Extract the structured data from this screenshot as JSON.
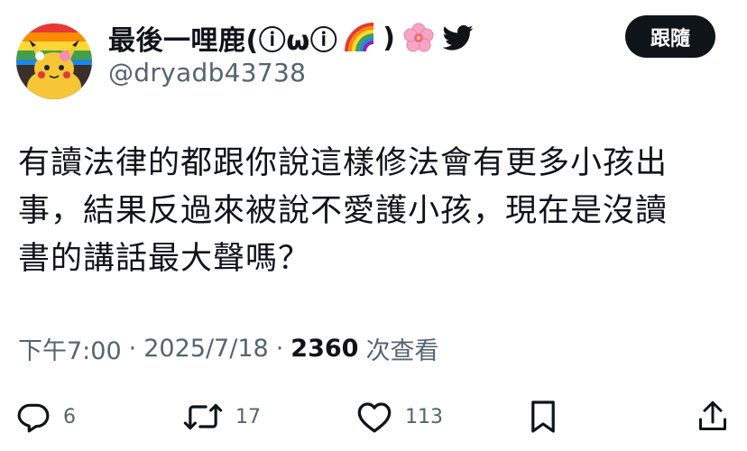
{
  "user": {
    "display_name": "最後一哩鹿(ⓘωⓘ",
    "name_suffix": ")",
    "handle": "@dryadb43738",
    "avatar_icon": "pikachu-avatar-icon",
    "emojis": [
      "rainbow-icon",
      "cherry-blossom-icon",
      "twitter-bird-icon"
    ]
  },
  "follow_button": {
    "label": "跟隨"
  },
  "tweet": {
    "lines": [
      "有讀法律的都跟你說這樣修法會有更多小孩出",
      "事，結果反過來被說不愛護小孩，現在是沒讀",
      "書的講話最大聲嗎？"
    ]
  },
  "meta": {
    "time": "下午7:00",
    "separator": "·",
    "date": "2025/7/18",
    "views": "2360",
    "views_label": "次查看"
  },
  "actions": {
    "replies": "6",
    "retweets": "17",
    "likes": "113"
  },
  "colors": {
    "text": "#0f1419",
    "secondary": "#536471",
    "button_bg": "#0f1419",
    "twitter_blue": "#1d9bf0"
  }
}
